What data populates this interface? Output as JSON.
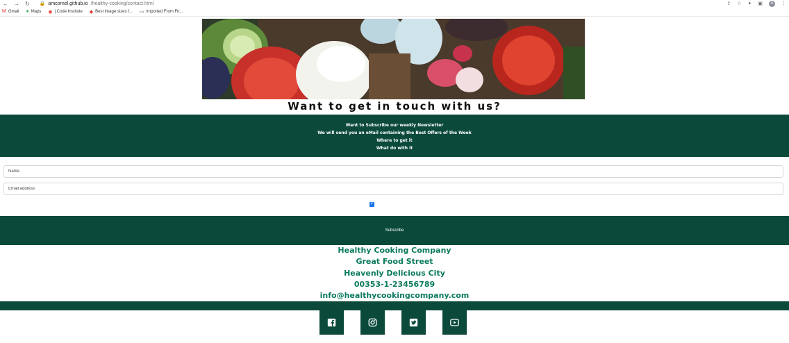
{
  "browser": {
    "url_host": "amcornel.github.io",
    "url_path": "/healthy-cooking/contact.html",
    "avatar_letter": "A",
    "bookmarks": [
      {
        "label": "Gmail",
        "icon": "gmail-icon"
      },
      {
        "label": "Maps",
        "icon": "maps-icon"
      },
      {
        "label": "| Code Institute",
        "icon": "code-institute-icon"
      },
      {
        "label": "Best image sizes f...",
        "icon": "bookmark-icon"
      },
      {
        "label": "Imported From Fir...",
        "icon": "folder-icon"
      }
    ]
  },
  "page": {
    "heading": "Want to get in touch with us?",
    "newsletter": {
      "line1": "Want to Subscribe our weekly Newsletter",
      "line2": "We will send you an eMail containing the Best Offers of the Week",
      "line3": "Where to get it",
      "line4": "What do with it"
    },
    "form": {
      "name_placeholder": "Name",
      "email_placeholder": "Email address",
      "subscribe_label": "Subscribe"
    },
    "contact": {
      "company": "Healthy Cooking Company",
      "street": "Great Food Street",
      "city": "Heavenly Delicious City",
      "phone": "00353-1-23456789",
      "email": "info@healthycookingcompany.com"
    },
    "social": [
      "facebook-icon",
      "instagram-icon",
      "twitter-icon",
      "youtube-icon"
    ]
  },
  "colors": {
    "brand_dark_green": "#0b4a3b",
    "contact_green": "#0b7a5c"
  }
}
